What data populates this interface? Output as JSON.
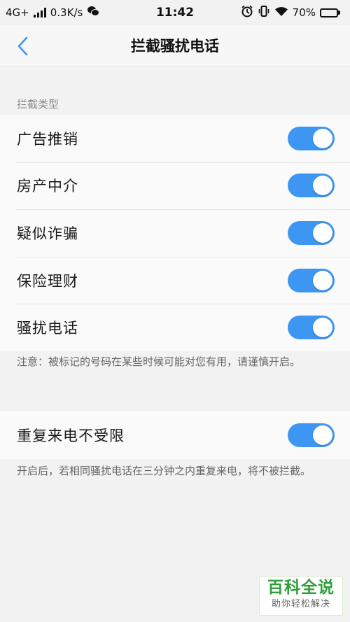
{
  "status_bar": {
    "network": "4G+",
    "speed": "0.3K/s",
    "time": "11:42",
    "battery": "70%",
    "battery_level": 0.7,
    "icons": [
      "signal-icon",
      "wechat-icon",
      "alarm-icon",
      "vibrate-icon",
      "wifi-icon",
      "battery-icon"
    ]
  },
  "header": {
    "back_icon": "chevron-left-icon",
    "title": "拦截骚扰电话"
  },
  "intercept": {
    "section_title": "拦截类型",
    "items": [
      {
        "label": "广告推销",
        "enabled": true
      },
      {
        "label": "房产中介",
        "enabled": true
      },
      {
        "label": "疑似诈骗",
        "enabled": true
      },
      {
        "label": "保险理财",
        "enabled": true
      },
      {
        "label": "骚扰电话",
        "enabled": true
      }
    ],
    "note": "注意：被标记的号码在某些时候可能对您有用，请谨慎开启。"
  },
  "repeat": {
    "label": "重复来电不受限",
    "enabled": true,
    "note": "开启后，若相同骚扰电话在三分钟之内重复来电，将不被拦截。"
  },
  "watermark": {
    "title": "百科全说",
    "subtitle": "助你轻松解决"
  },
  "colors": {
    "toggle_on": "#3e96f3",
    "back_arrow": "#3e96f3",
    "watermark": "#2f9e3a"
  }
}
